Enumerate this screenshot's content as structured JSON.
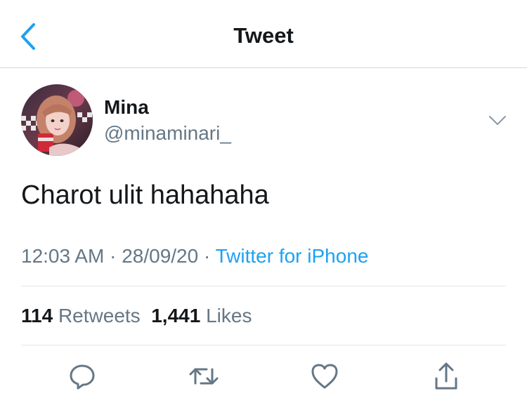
{
  "header": {
    "title": "Tweet",
    "back_icon": "chevron-left-icon"
  },
  "tweet": {
    "author_name": "Mina",
    "author_handle": "@minaminari_",
    "text": "Charot ulit hahahaha",
    "time": "12:03 AM",
    "date": "28/09/20",
    "separator": "·",
    "source": "Twitter for iPhone",
    "retweets_count": "114",
    "retweets_label": "Retweets",
    "likes_count": "1,441",
    "likes_label": "Likes"
  },
  "actions": [
    {
      "name": "reply",
      "icon": "reply-icon"
    },
    {
      "name": "retweet",
      "icon": "retweet-icon"
    },
    {
      "name": "like",
      "icon": "heart-icon"
    },
    {
      "name": "share",
      "icon": "share-icon"
    }
  ],
  "colors": {
    "accent": "#1da1f2",
    "text": "#14171a",
    "secondary": "#657786",
    "divider": "#e1e8ed"
  }
}
